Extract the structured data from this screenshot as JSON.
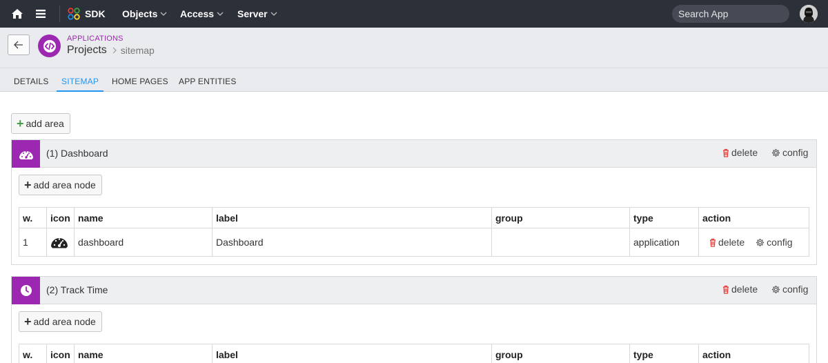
{
  "topbar": {
    "icons": {
      "home": "home-icon",
      "menu": "hamburger-menu-icon",
      "sdk": "sdk-logo-icon"
    },
    "sdk_label": "SDK",
    "menus": [
      "Objects",
      "Access",
      "Server"
    ],
    "search_placeholder": "Search App"
  },
  "header": {
    "section": "APPLICATIONS",
    "title": "Projects",
    "subtitle": "sitemap",
    "accent": "#9c27b0"
  },
  "tabs": [
    {
      "label": "DETAILS",
      "active": false
    },
    {
      "label": "SITEMAP",
      "active": true
    },
    {
      "label": "HOME PAGES",
      "active": false
    },
    {
      "label": "APP ENTITIES",
      "active": false
    }
  ],
  "add_area_label": "add area",
  "areas": [
    {
      "title": "(1) Dashboard",
      "icon": "dashboard-gauge-icon",
      "delete_label": "delete",
      "config_label": "config",
      "add_node_label": "add area node",
      "columns": [
        "w.",
        "icon",
        "name",
        "label",
        "group",
        "type",
        "action"
      ],
      "rows": [
        {
          "w": "1",
          "icon": "dashboard-gauge-icon",
          "name": "dashboard",
          "label": "Dashboard",
          "group": "",
          "type": "application",
          "delete_label": "delete",
          "config_label": "config"
        }
      ]
    },
    {
      "title": "(2) Track Time",
      "icon": "clock-icon",
      "delete_label": "delete",
      "config_label": "config",
      "add_node_label": "add area node",
      "columns": [
        "w.",
        "icon",
        "name",
        "label",
        "group",
        "type",
        "action"
      ],
      "rows": []
    }
  ],
  "colors": {
    "topbar": "#2c3038",
    "accent_purple": "#9c27b0",
    "tab_active": "#2196f3",
    "delete_red": "#e53935",
    "add_green": "#43a047"
  }
}
